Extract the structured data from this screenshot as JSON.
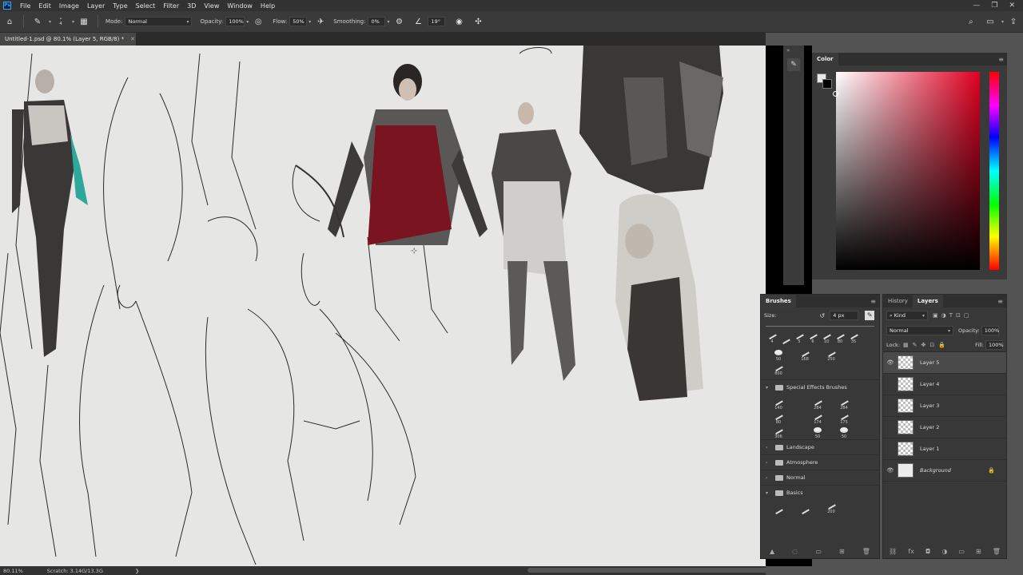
{
  "menubar": {
    "app_icon": "Ps",
    "items": [
      "File",
      "Edit",
      "Image",
      "Layer",
      "Type",
      "Select",
      "Filter",
      "3D",
      "View",
      "Window",
      "Help"
    ],
    "window_controls": [
      "minimize-icon",
      "restore-icon",
      "close-icon"
    ]
  },
  "options": {
    "brush_size": "4",
    "mode_label": "Mode:",
    "mode_value": "Normal",
    "opacity_label": "Opacity:",
    "opacity_value": "100%",
    "flow_label": "Flow:",
    "flow_value": "50%",
    "smoothing_label": "Smoothing:",
    "smoothing_value": "0%",
    "angle_value": "19°"
  },
  "document": {
    "tab_title": "Untitled-1.psd @ 80.1% (Layer 5, RGB/8) *",
    "zoom": "80.11%",
    "scratch": "Scratch: 3.14G/13.3G"
  },
  "color_panel": {
    "title": "Color",
    "foreground": "#e8e8e8",
    "background": "#000000"
  },
  "brushes_panel": {
    "title": "Brushes",
    "size_label": "Size:",
    "size_value": "4 px",
    "row1": [
      "4",
      "",
      "5",
      "6",
      "10",
      "80",
      "35"
    ],
    "row2": [
      "50",
      "168",
      "250"
    ],
    "row3": [
      "800"
    ],
    "special_effects_title": "Special Effects Brushes",
    "se_row1": [
      "140",
      "284",
      "284"
    ],
    "se_row2": [
      "80",
      "174",
      "175"
    ],
    "se_row3": [
      "306",
      "50",
      "50"
    ],
    "folders": [
      "Landscape",
      "Atmosphere",
      "Normal",
      "Basics"
    ],
    "basics_row": [
      "200"
    ]
  },
  "layers_panel": {
    "tabs": [
      "History",
      "Layers"
    ],
    "active_tab": "Layers",
    "kind_label": "Kind",
    "blend_mode": "Normal",
    "opacity_label": "Opacity:",
    "opacity_value": "100%",
    "lock_label": "Lock:",
    "fill_label": "Fill:",
    "fill_value": "100%",
    "layers": [
      {
        "name": "Layer 5",
        "visible": true,
        "active": true
      },
      {
        "name": "Layer 4",
        "visible": false,
        "active": false
      },
      {
        "name": "Layer 3",
        "visible": false,
        "active": false
      },
      {
        "name": "Layer 2",
        "visible": false,
        "active": false
      },
      {
        "name": "Layer 1",
        "visible": false,
        "active": false
      },
      {
        "name": "Background",
        "visible": true,
        "active": false,
        "locked": true
      }
    ]
  },
  "colors": {
    "accent": "#31a8ff",
    "canvas": "#e6e6e4",
    "dress_red": "#7a1420"
  }
}
